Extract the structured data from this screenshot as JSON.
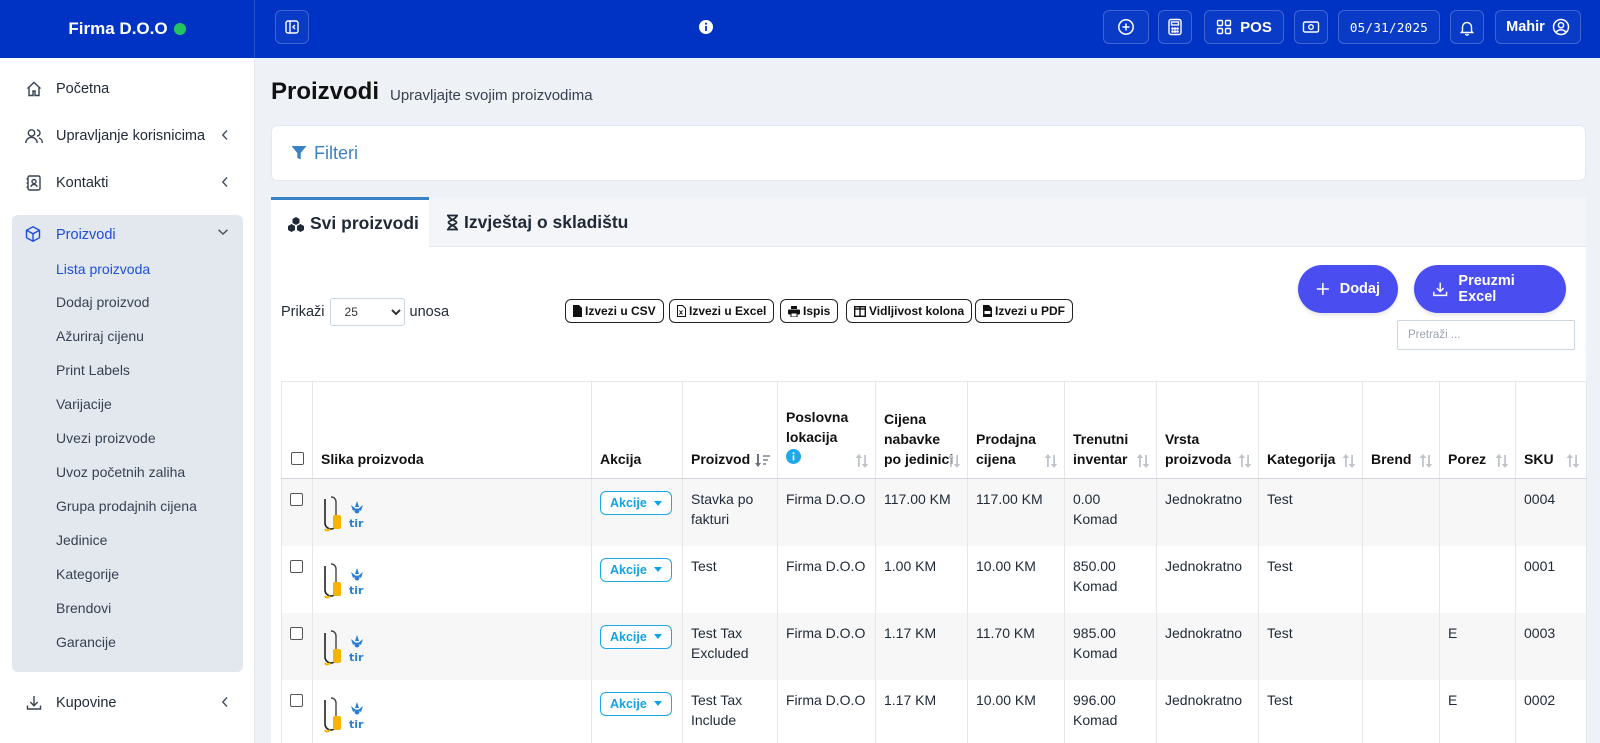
{
  "topbar": {
    "brand": "Firma D.O.O",
    "pos_label": "POS",
    "date": "05/31/2025",
    "user": "Mahir"
  },
  "sidebar": {
    "items": [
      {
        "label": "Početna",
        "icon": "home-icon"
      },
      {
        "label": "Upravljanje korisnicima",
        "icon": "users-icon"
      },
      {
        "label": "Kontakti",
        "icon": "contacts-icon"
      },
      {
        "label": "Proizvodi",
        "icon": "cube-icon"
      },
      {
        "label": "Kupovine",
        "icon": "download-icon"
      }
    ],
    "subitems": [
      "Lista proizvoda",
      "Dodaj proizvod",
      "Ažuriraj cijenu",
      "Print Labels",
      "Varijacije",
      "Uvezi proizvode",
      "Uvoz početnih zaliha",
      "Grupa prodajnih cijena",
      "Jedinice",
      "Kategorije",
      "Brendovi",
      "Garancije"
    ]
  },
  "page": {
    "title": "Proizvodi",
    "subtitle": "Upravljajte svojim proizvodima",
    "filters": "Filteri"
  },
  "tabs": {
    "all": "Svi proizvodi",
    "stock": "Izvještaj o skladištu"
  },
  "controls": {
    "show_label": "Prikaži",
    "show_value": "25",
    "entries_label": "unosa",
    "export_csv": "Izvezi u CSV",
    "export_excel": "Izvezi u Excel",
    "print": "Ispis",
    "columns": "Vidljivost kolona",
    "export_pdf": "Izvezi u PDF",
    "add": "Dodaj",
    "download_excel": "Preuzmi Excel",
    "search_placeholder": "Pretraži ..."
  },
  "table": {
    "headers": {
      "image": "Slika proizvoda",
      "action": "Akcija",
      "product": "Proizvod",
      "location": "Poslovna lokacija",
      "purchase": "Cijena nabavke po jedinici",
      "selling": "Prodajna cijena",
      "stock": "Trenutni inventar",
      "type": "Vrsta proizvoda",
      "category": "Kategorija",
      "brand": "Brend",
      "tax": "Porez",
      "sku": "SKU"
    },
    "action_label": "Akcije",
    "rows": [
      {
        "product": "Stavka po fakturi",
        "location": "Firma D.O.O",
        "purchase": "117.00 KM",
        "selling": "117.00 KM",
        "stock": "0.00 Komad",
        "type": "Jednokratno",
        "category": "Test",
        "brand": "",
        "tax": "",
        "sku": "0004"
      },
      {
        "product": "Test",
        "location": "Firma D.O.O",
        "purchase": "1.00 KM",
        "selling": "10.00 KM",
        "stock": "850.00 Komad",
        "type": "Jednokratno",
        "category": "Test",
        "brand": "",
        "tax": "",
        "sku": "0001"
      },
      {
        "product": "Test Tax Excluded",
        "location": "Firma D.O.O",
        "purchase": "1.17 KM",
        "selling": "11.70 KM",
        "stock": "985.00 Komad",
        "type": "Jednokratno",
        "category": "Test",
        "brand": "",
        "tax": "E",
        "sku": "0003"
      },
      {
        "product": "Test Tax Include",
        "location": "Firma D.O.O",
        "purchase": "1.17 KM",
        "selling": "10.00 KM",
        "stock": "996.00 Komad",
        "type": "Jednokratno",
        "category": "Test",
        "brand": "",
        "tax": "E",
        "sku": "0002"
      }
    ]
  },
  "colors": {
    "topbar": "#0033c4",
    "accent": "#1d4ed8",
    "pill": "#4a4ef0",
    "akcije": "#12a3e6",
    "online": "#22c55e"
  }
}
